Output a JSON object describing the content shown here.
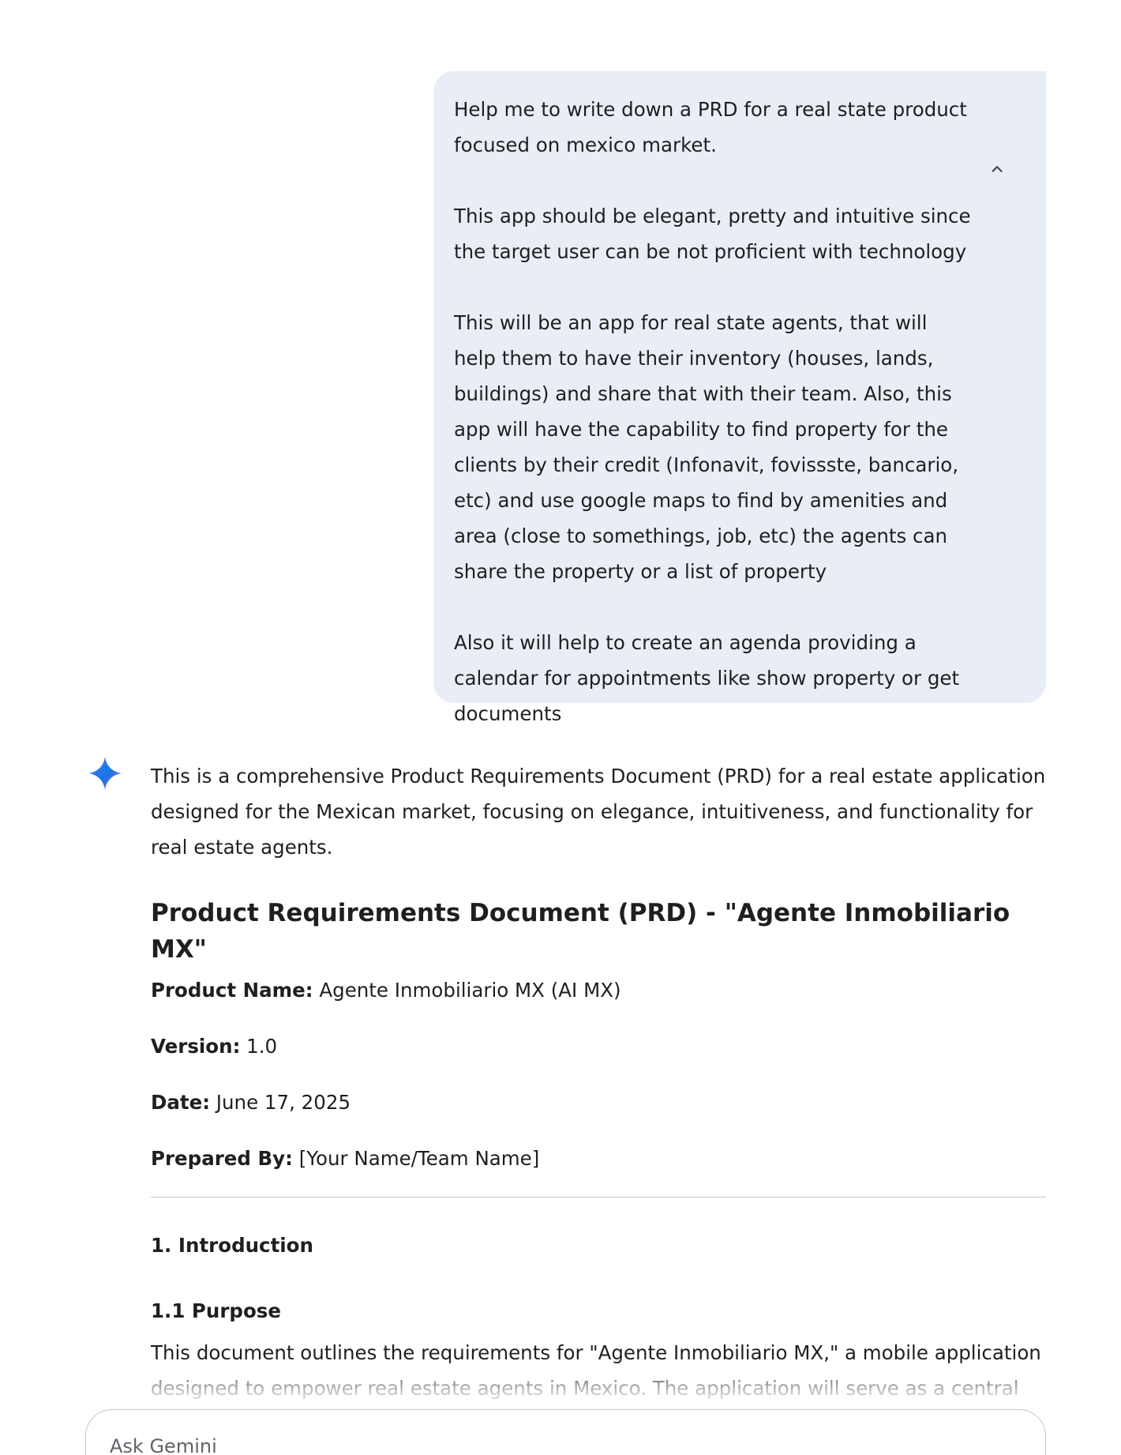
{
  "user_prompt": {
    "paragraphs": [
      "Help me to write down a PRD for a real state product focused on mexico market.",
      "This app should be elegant, pretty and intuitive since the target user can be not proficient with technology",
      "This will be an app for real state agents, that will help them to have their inventory (houses, lands, buildings) and share that with their team. Also, this app will have the capability to find property for the clients by their credit (Infonavit, fovissste, bancario, etc) and use google maps to find by amenities and area (close to somethings, job, etc) the agents can share the property or a list of property",
      "Also it will help to create an agenda providing a calendar for appointments like show property or get documents"
    ],
    "collapse_icon": "chevron-up-icon"
  },
  "response": {
    "icon": "gemini-sparkle-icon",
    "icon_colors": [
      "#4285f4",
      "#9b72cb",
      "#1a73e8"
    ],
    "intro": "This is a comprehensive Product Requirements Document (PRD) for a real estate application designed for the Mexican market, focusing on elegance, intuitiveness, and functionality for real estate agents.",
    "title": "Product Requirements Document (PRD) - \"Agente Inmobiliario MX\"",
    "meta": [
      {
        "label": "Product Name:",
        "value": " Agente Inmobiliario MX (AI MX)"
      },
      {
        "label": "Version:",
        "value": " 1.0"
      },
      {
        "label": "Date:",
        "value": " June 17, 2025"
      },
      {
        "label": "Prepared By:",
        "value": " [Your Name/Team Name]"
      }
    ],
    "section_heading": "1. Introduction",
    "subsection_heading": "1.1 Purpose",
    "body": "This document outlines the requirements for \"Agente Inmobiliario MX,\" a mobile application designed to empower real estate agents in Mexico. The application will serve as a central hub for managing property inventories, facilitating team collaboration, streamlining client property"
  },
  "input": {
    "placeholder": "Ask Gemini",
    "value": ""
  }
}
